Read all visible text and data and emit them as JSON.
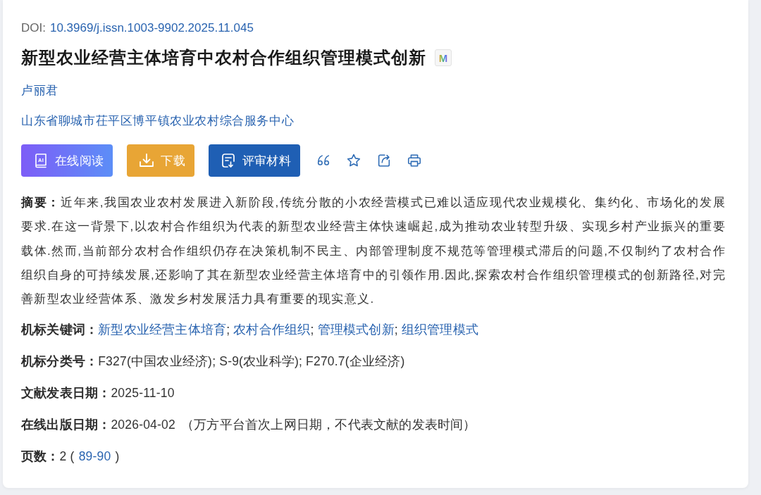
{
  "doi": {
    "label": "DOI:",
    "value": "10.3969/j.issn.1003-9902.2025.11.045"
  },
  "title": {
    "text": "新型农业经营主体培育中农村合作组织管理模式创新",
    "badge": "M"
  },
  "authors": [
    "卢丽君"
  ],
  "affiliations": [
    "山东省聊城市茌平区博平镇农业农村综合服务中心"
  ],
  "actions": [
    {
      "kind": "read",
      "label": "在线阅读",
      "icon_text": "AI"
    },
    {
      "kind": "download",
      "label": "下载"
    },
    {
      "kind": "review",
      "label": "评审材料"
    }
  ],
  "abstract": "**摘要：**近年来,我国农业农村发展进入新阶段,传统分散的小农经营模式已难以适应现代农业规模化、集约化、市场化的发展要求.在这一背景下,以农村合作组织为代表的新型农业经营主体快速崛起,成为推动农业转型升级、实现乡村产业振兴的重要载体.然而,当前部分农村合作组织仍存在决策机制不民主、内部管理制度不规范等管理模式滞后的问题,不仅制约了农村合作组织自身的可持续发展,还影响了其在新型农业经营主体培育中的引领作用.因此,探索农村合作组织管理模式的创新路径,对完善新型农业经营体系、激发乡村发展活力具有重要的现实意义.",
  "fields": [
    {
      "kind": "links",
      "label": "机标关键词：",
      "items": [
        "新型农业经营主体培育",
        "农村合作组织",
        "管理模式创新",
        "组织管理模式"
      ],
      "separator": ";"
    },
    {
      "kind": "text",
      "label": "机标分类号：",
      "value": "F327(中国农业经济); S-9(农业科学); F270.7(企业经济)"
    },
    {
      "kind": "text",
      "label": "文献发表日期：",
      "value": "2025-11-10"
    },
    {
      "kind": "text",
      "label": "在线出版日期：",
      "value": "2026-04-02",
      "note": "（万方平台首次上网日期，不代表文献的发表时间）"
    },
    {
      "kind": "pages",
      "label": "页数：",
      "value": "2 (",
      "link": "89-90",
      "suffix": ")"
    }
  ]
}
